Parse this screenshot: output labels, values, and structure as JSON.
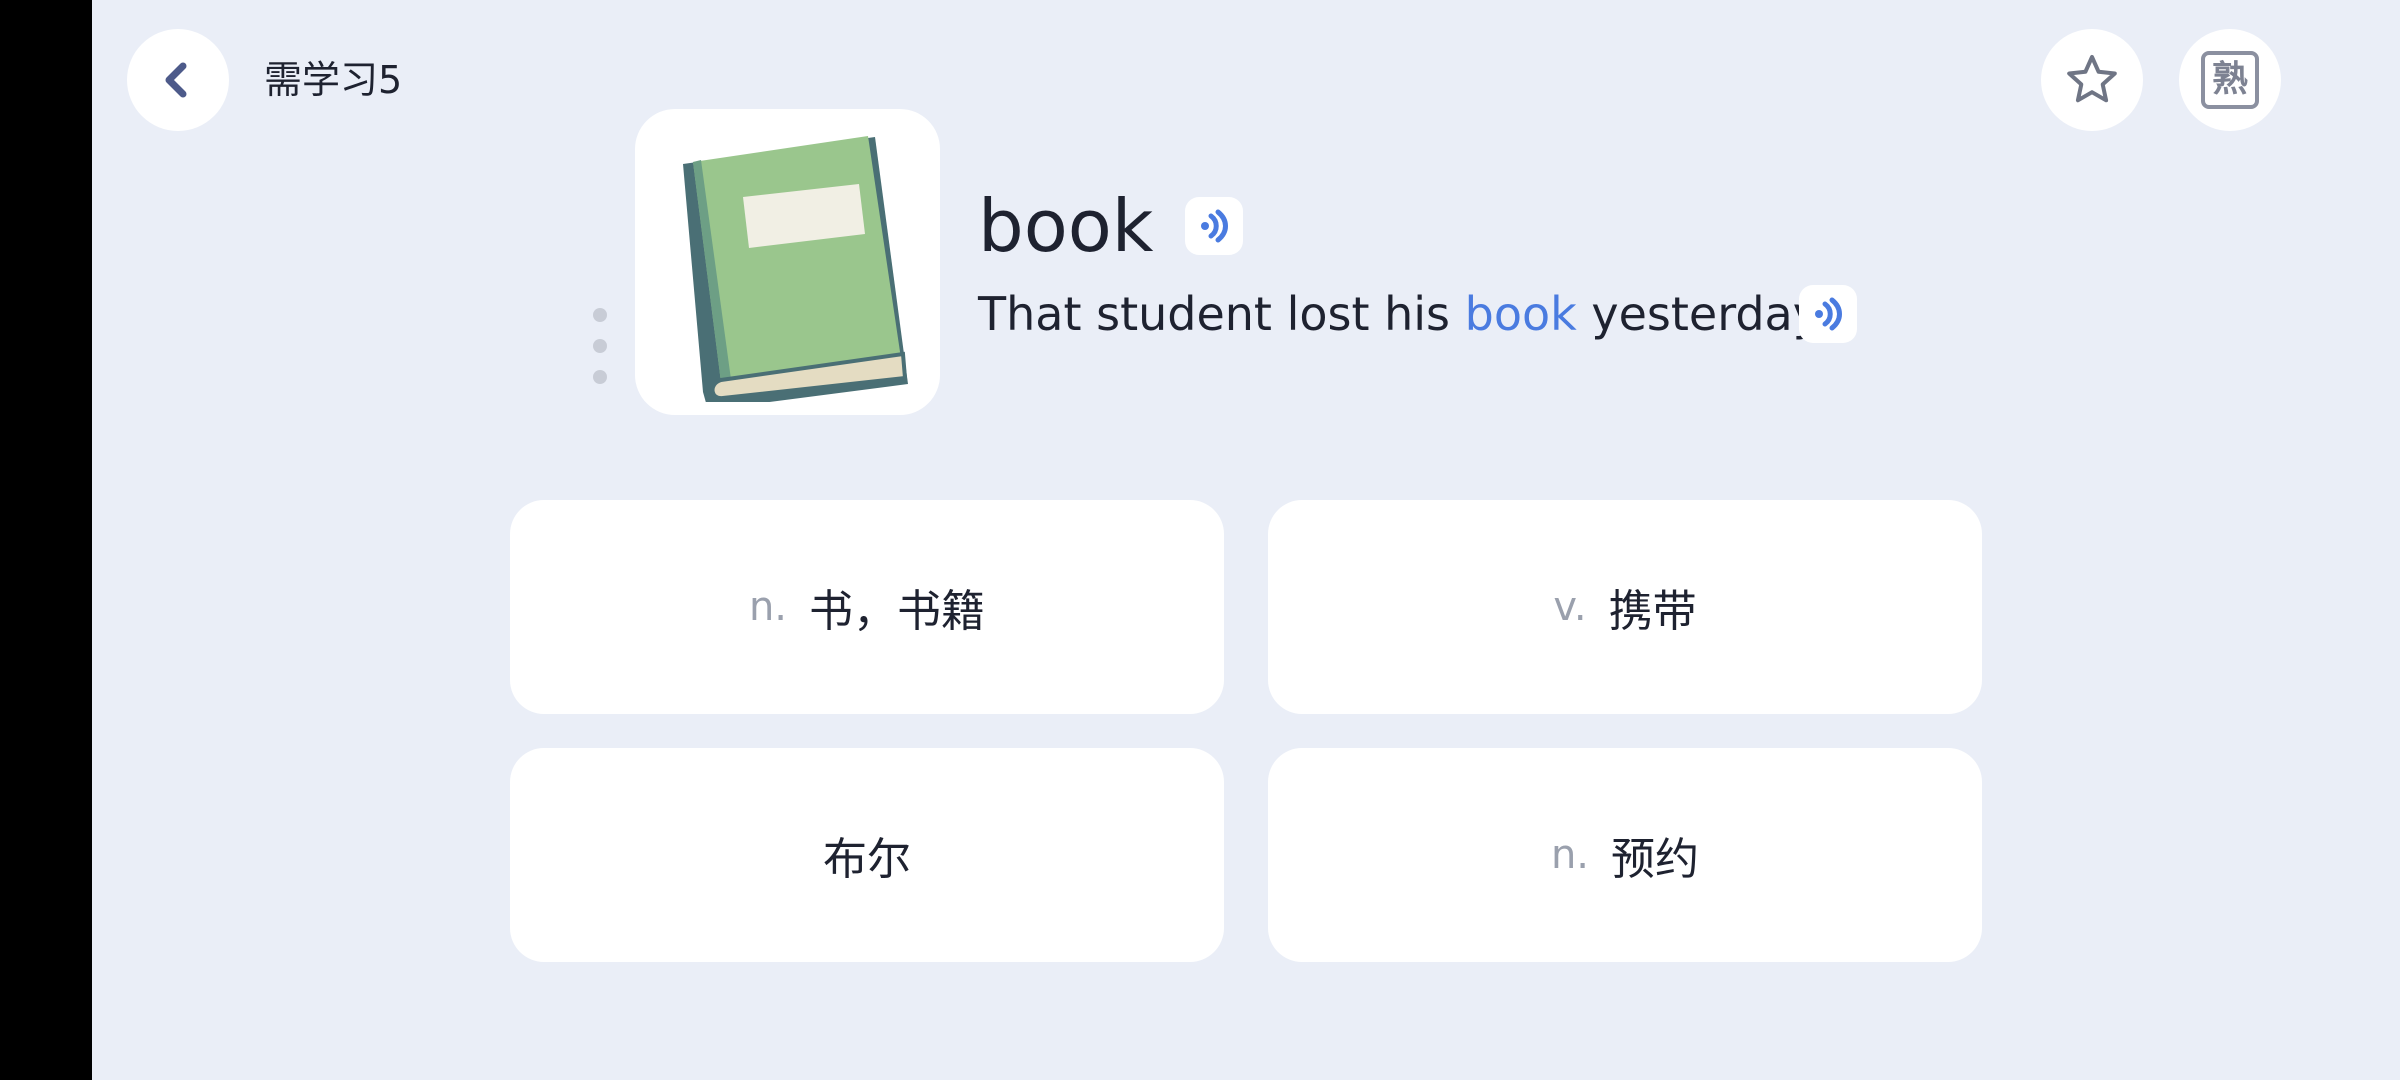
{
  "header": {
    "title": "需学习5",
    "back_icon": "chevron-left-icon",
    "star_icon": "star-outline-icon",
    "known_label": "熟"
  },
  "word_card": {
    "image_icon": "green-book-icon",
    "word": "book",
    "sentence_before": "That student lost his ",
    "sentence_highlight": "book",
    "sentence_after": " yesterday.",
    "highlight_color": "#4a7be0",
    "speaker_icon": "speaker-sound-icon"
  },
  "options": [
    {
      "pos": "n.",
      "meaning": "书，书籍"
    },
    {
      "pos": "v.",
      "meaning": "携带"
    },
    {
      "pos": "",
      "meaning": "布尔"
    },
    {
      "pos": "n.",
      "meaning": "预约"
    }
  ],
  "colors": {
    "background": "#eaeef7",
    "card": "#ffffff",
    "accent": "#4a7be0",
    "text": "#1e2230",
    "muted": "#9aa0ad"
  }
}
